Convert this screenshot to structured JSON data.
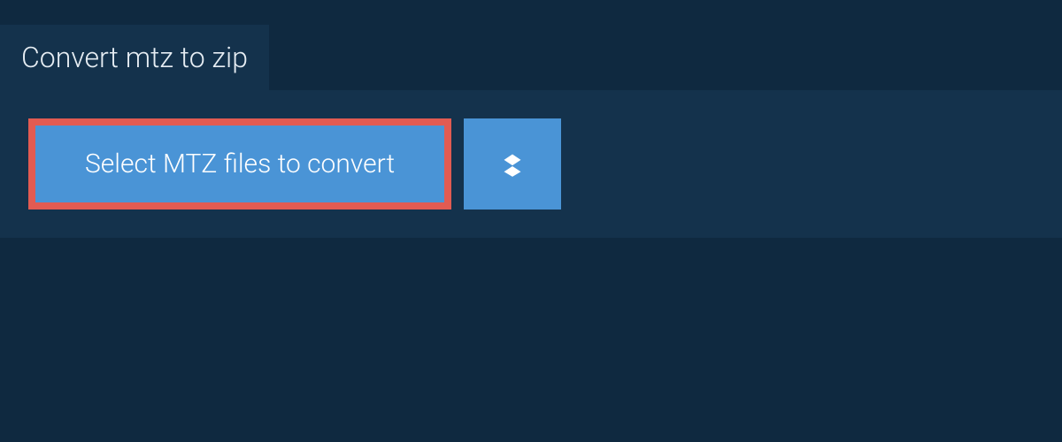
{
  "tab": {
    "title": "Convert mtz to zip"
  },
  "actions": {
    "select_button_label": "Select MTZ files to convert"
  }
}
